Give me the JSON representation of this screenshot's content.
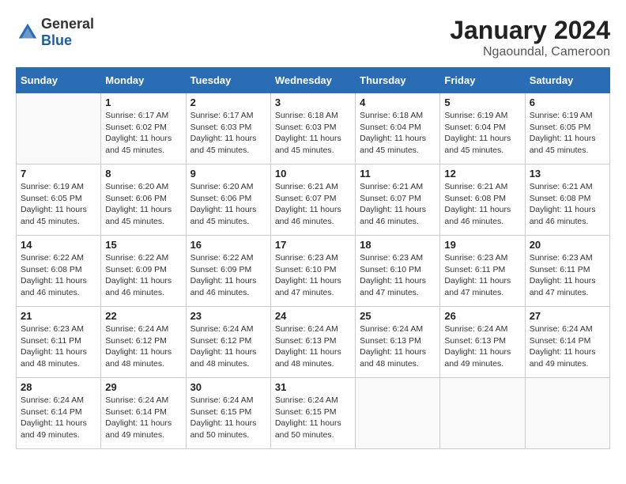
{
  "header": {
    "logo_general": "General",
    "logo_blue": "Blue",
    "month": "January 2024",
    "location": "Ngaoundal, Cameroon"
  },
  "days_of_week": [
    "Sunday",
    "Monday",
    "Tuesday",
    "Wednesday",
    "Thursday",
    "Friday",
    "Saturday"
  ],
  "weeks": [
    [
      {
        "day": "",
        "sunrise": "",
        "sunset": "",
        "daylight": ""
      },
      {
        "day": "1",
        "sunrise": "Sunrise: 6:17 AM",
        "sunset": "Sunset: 6:02 PM",
        "daylight": "Daylight: 11 hours and 45 minutes."
      },
      {
        "day": "2",
        "sunrise": "Sunrise: 6:17 AM",
        "sunset": "Sunset: 6:03 PM",
        "daylight": "Daylight: 11 hours and 45 minutes."
      },
      {
        "day": "3",
        "sunrise": "Sunrise: 6:18 AM",
        "sunset": "Sunset: 6:03 PM",
        "daylight": "Daylight: 11 hours and 45 minutes."
      },
      {
        "day": "4",
        "sunrise": "Sunrise: 6:18 AM",
        "sunset": "Sunset: 6:04 PM",
        "daylight": "Daylight: 11 hours and 45 minutes."
      },
      {
        "day": "5",
        "sunrise": "Sunrise: 6:19 AM",
        "sunset": "Sunset: 6:04 PM",
        "daylight": "Daylight: 11 hours and 45 minutes."
      },
      {
        "day": "6",
        "sunrise": "Sunrise: 6:19 AM",
        "sunset": "Sunset: 6:05 PM",
        "daylight": "Daylight: 11 hours and 45 minutes."
      }
    ],
    [
      {
        "day": "7",
        "sunrise": "Sunrise: 6:19 AM",
        "sunset": "Sunset: 6:05 PM",
        "daylight": "Daylight: 11 hours and 45 minutes."
      },
      {
        "day": "8",
        "sunrise": "Sunrise: 6:20 AM",
        "sunset": "Sunset: 6:06 PM",
        "daylight": "Daylight: 11 hours and 45 minutes."
      },
      {
        "day": "9",
        "sunrise": "Sunrise: 6:20 AM",
        "sunset": "Sunset: 6:06 PM",
        "daylight": "Daylight: 11 hours and 45 minutes."
      },
      {
        "day": "10",
        "sunrise": "Sunrise: 6:21 AM",
        "sunset": "Sunset: 6:07 PM",
        "daylight": "Daylight: 11 hours and 46 minutes."
      },
      {
        "day": "11",
        "sunrise": "Sunrise: 6:21 AM",
        "sunset": "Sunset: 6:07 PM",
        "daylight": "Daylight: 11 hours and 46 minutes."
      },
      {
        "day": "12",
        "sunrise": "Sunrise: 6:21 AM",
        "sunset": "Sunset: 6:08 PM",
        "daylight": "Daylight: 11 hours and 46 minutes."
      },
      {
        "day": "13",
        "sunrise": "Sunrise: 6:21 AM",
        "sunset": "Sunset: 6:08 PM",
        "daylight": "Daylight: 11 hours and 46 minutes."
      }
    ],
    [
      {
        "day": "14",
        "sunrise": "Sunrise: 6:22 AM",
        "sunset": "Sunset: 6:08 PM",
        "daylight": "Daylight: 11 hours and 46 minutes."
      },
      {
        "day": "15",
        "sunrise": "Sunrise: 6:22 AM",
        "sunset": "Sunset: 6:09 PM",
        "daylight": "Daylight: 11 hours and 46 minutes."
      },
      {
        "day": "16",
        "sunrise": "Sunrise: 6:22 AM",
        "sunset": "Sunset: 6:09 PM",
        "daylight": "Daylight: 11 hours and 46 minutes."
      },
      {
        "day": "17",
        "sunrise": "Sunrise: 6:23 AM",
        "sunset": "Sunset: 6:10 PM",
        "daylight": "Daylight: 11 hours and 47 minutes."
      },
      {
        "day": "18",
        "sunrise": "Sunrise: 6:23 AM",
        "sunset": "Sunset: 6:10 PM",
        "daylight": "Daylight: 11 hours and 47 minutes."
      },
      {
        "day": "19",
        "sunrise": "Sunrise: 6:23 AM",
        "sunset": "Sunset: 6:11 PM",
        "daylight": "Daylight: 11 hours and 47 minutes."
      },
      {
        "day": "20",
        "sunrise": "Sunrise: 6:23 AM",
        "sunset": "Sunset: 6:11 PM",
        "daylight": "Daylight: 11 hours and 47 minutes."
      }
    ],
    [
      {
        "day": "21",
        "sunrise": "Sunrise: 6:23 AM",
        "sunset": "Sunset: 6:11 PM",
        "daylight": "Daylight: 11 hours and 48 minutes."
      },
      {
        "day": "22",
        "sunrise": "Sunrise: 6:24 AM",
        "sunset": "Sunset: 6:12 PM",
        "daylight": "Daylight: 11 hours and 48 minutes."
      },
      {
        "day": "23",
        "sunrise": "Sunrise: 6:24 AM",
        "sunset": "Sunset: 6:12 PM",
        "daylight": "Daylight: 11 hours and 48 minutes."
      },
      {
        "day": "24",
        "sunrise": "Sunrise: 6:24 AM",
        "sunset": "Sunset: 6:13 PM",
        "daylight": "Daylight: 11 hours and 48 minutes."
      },
      {
        "day": "25",
        "sunrise": "Sunrise: 6:24 AM",
        "sunset": "Sunset: 6:13 PM",
        "daylight": "Daylight: 11 hours and 48 minutes."
      },
      {
        "day": "26",
        "sunrise": "Sunrise: 6:24 AM",
        "sunset": "Sunset: 6:13 PM",
        "daylight": "Daylight: 11 hours and 49 minutes."
      },
      {
        "day": "27",
        "sunrise": "Sunrise: 6:24 AM",
        "sunset": "Sunset: 6:14 PM",
        "daylight": "Daylight: 11 hours and 49 minutes."
      }
    ],
    [
      {
        "day": "28",
        "sunrise": "Sunrise: 6:24 AM",
        "sunset": "Sunset: 6:14 PM",
        "daylight": "Daylight: 11 hours and 49 minutes."
      },
      {
        "day": "29",
        "sunrise": "Sunrise: 6:24 AM",
        "sunset": "Sunset: 6:14 PM",
        "daylight": "Daylight: 11 hours and 49 minutes."
      },
      {
        "day": "30",
        "sunrise": "Sunrise: 6:24 AM",
        "sunset": "Sunset: 6:15 PM",
        "daylight": "Daylight: 11 hours and 50 minutes."
      },
      {
        "day": "31",
        "sunrise": "Sunrise: 6:24 AM",
        "sunset": "Sunset: 6:15 PM",
        "daylight": "Daylight: 11 hours and 50 minutes."
      },
      {
        "day": "",
        "sunrise": "",
        "sunset": "",
        "daylight": ""
      },
      {
        "day": "",
        "sunrise": "",
        "sunset": "",
        "daylight": ""
      },
      {
        "day": "",
        "sunrise": "",
        "sunset": "",
        "daylight": ""
      }
    ]
  ]
}
